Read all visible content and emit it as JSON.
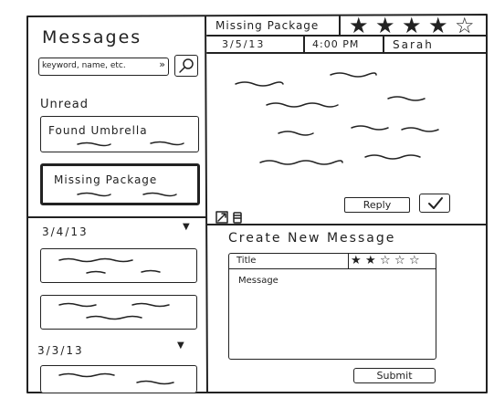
{
  "sidebar": {
    "title": "Messages",
    "search_value": "keyword, name, etc.",
    "search_icon": "magnifier",
    "dropdown_icon": "double-chevron-down",
    "unread_label": "Unread",
    "unread_items": [
      {
        "title": "Found Umbrella"
      },
      {
        "title": "Missing Package"
      }
    ],
    "groups": [
      {
        "date": "3/4/13",
        "toggle_icon": "triangle-down"
      },
      {
        "date": "3/3/13",
        "toggle_icon": "triangle-down"
      }
    ]
  },
  "message_view": {
    "title": "Missing Package",
    "rating": 4,
    "rating_max": 5,
    "date": "3/5/13",
    "time": "4:00 PM",
    "sender": "Sarah",
    "reply_label": "Reply",
    "confirm_icon": "checkmark",
    "expand_icon": "expand-arrow",
    "delete_icon": "trash-can"
  },
  "compose": {
    "heading": "Create New Message",
    "title_placeholder": "Title",
    "rating": 2,
    "rating_max": 5,
    "body_placeholder": "Message",
    "submit_label": "Submit"
  }
}
